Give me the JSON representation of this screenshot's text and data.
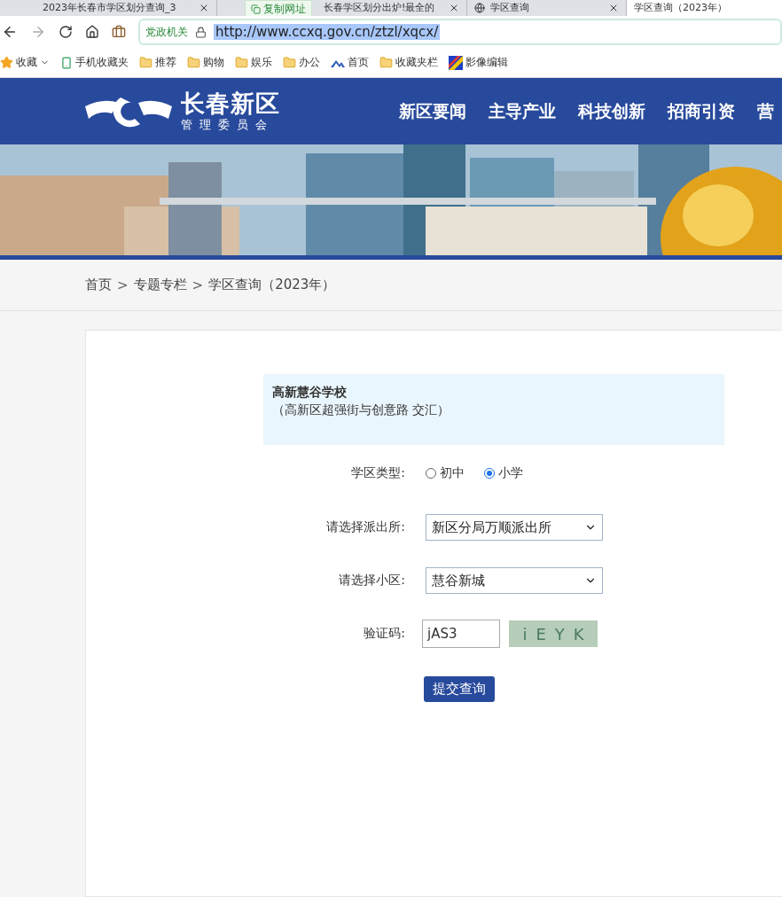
{
  "browser": {
    "tabs": [
      {
        "title": "2023年长春市学区划分查询_3",
        "selected": false
      },
      {
        "title": "长春学区划分出炉!最全的",
        "selected": false
      },
      {
        "title": "学区查询",
        "selected": false
      },
      {
        "title": "学区查询（2023年）",
        "selected": true
      }
    ],
    "tooltip": "复制网址",
    "security_badge": "党政机关",
    "url": "http://www.ccxq.gov.cn/ztzl/xqcx/",
    "bookmarks": [
      {
        "label": "收藏",
        "kind": "star"
      },
      {
        "label": "手机收藏夹",
        "kind": "phone"
      },
      {
        "label": "推荐",
        "kind": "folder"
      },
      {
        "label": "购物",
        "kind": "folder"
      },
      {
        "label": "娱乐",
        "kind": "folder"
      },
      {
        "label": "办公",
        "kind": "folder"
      },
      {
        "label": "首页",
        "kind": "site"
      },
      {
        "label": "收藏夹栏",
        "kind": "folder"
      },
      {
        "label": "影像编辑",
        "kind": "app"
      }
    ]
  },
  "header": {
    "logo_title": "长春新区",
    "logo_subtitle": "管理委员会",
    "nav": [
      "新区要闻",
      "主导产业",
      "科技创新",
      "招商引资",
      "营"
    ]
  },
  "breadcrumb": [
    "首页",
    "专题专栏",
    "学区查询（2023年）"
  ],
  "breadcrumb_separator": ">",
  "school": {
    "name": "高新慧谷学校",
    "address": "（高新区超强街与创意路 交汇）"
  },
  "form": {
    "type_label": "学区类型:",
    "types": [
      {
        "label": "初中",
        "selected": false
      },
      {
        "label": "小学",
        "selected": true
      }
    ],
    "station_label": "请选择派出所:",
    "station": "新区分局万顺派出所",
    "community_label": "请选择小区:",
    "community": "慧谷新城",
    "captcha_label": "验证码:",
    "captcha_value": "jAS3",
    "captcha_image": [
      "i",
      "E",
      "Y",
      "K"
    ],
    "submit": "提交查询"
  }
}
